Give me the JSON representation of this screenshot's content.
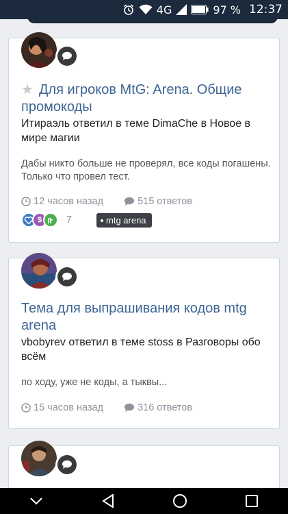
{
  "status_bar": {
    "network": "4G",
    "battery": "97 %",
    "time": "12:37"
  },
  "topics": [
    {
      "title": "Для игроков MtG: Arena. Общие промокоды",
      "activity": "Итираэль ответил в теме DimaChe в Новое в мире магии",
      "snippet": "Дабы никто больше не проверял, все коды погашены. Только что провел тест.",
      "time": "12 часов назад",
      "replies": "515 ответов",
      "reaction_count": "7",
      "tag": "mtg arena"
    },
    {
      "title": "Тема для выпрашивания кодов mtg arena",
      "activity": "vbobyrev ответил в теме stoss в Разговоры обо всём",
      "snippet": "по ходу, уже не коды, а тыквы...",
      "time": "15 часов назад",
      "replies": "316 ответов"
    }
  ],
  "colors": {
    "title_link": "#3d6594",
    "card_border": "#c9d6e4",
    "page_bg": "#eceef1",
    "status_bar_bg": "#1b2a3c",
    "reaction_like": "#3a7bbf",
    "reaction_thanks": "#9b59b6",
    "reaction_agree": "#4caf50"
  }
}
